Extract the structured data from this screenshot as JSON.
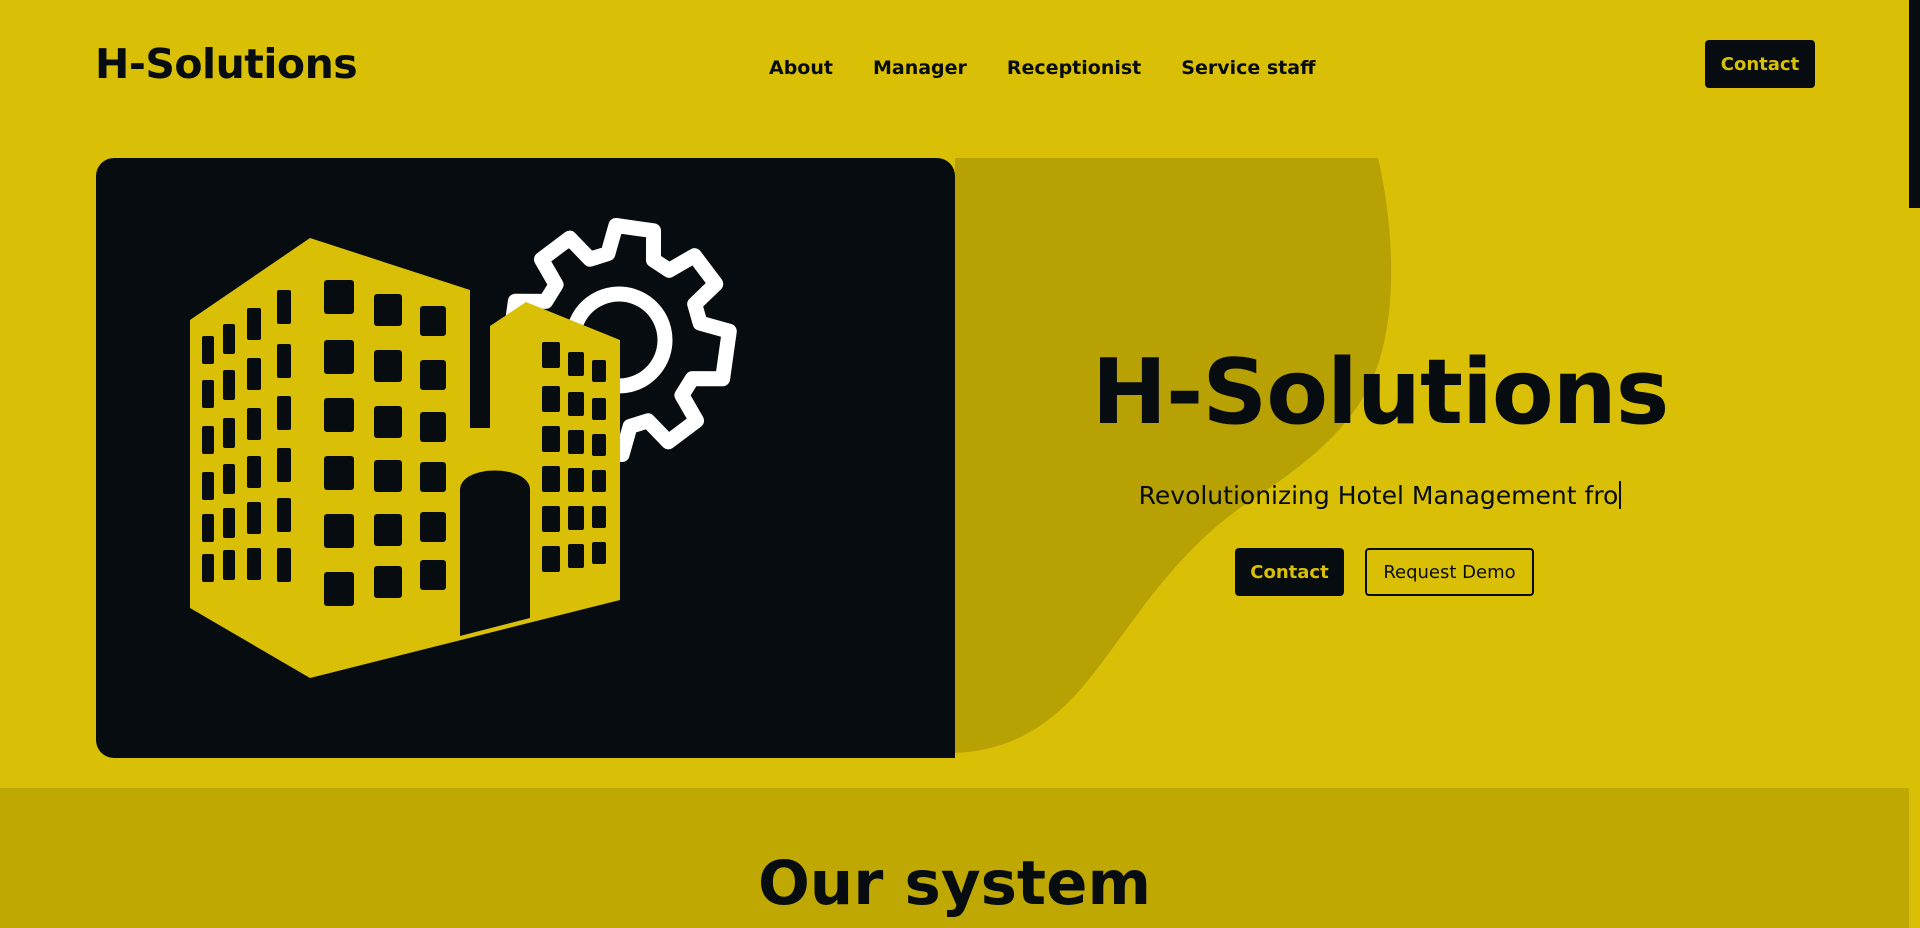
{
  "brand": {
    "logo_text": "H-Solutions"
  },
  "nav": {
    "items": [
      "About",
      "Manager",
      "Receptionist",
      "Service staff"
    ],
    "contact_label": "Contact"
  },
  "hero": {
    "title": "H-Solutions",
    "subtitle": "Revolutionizing Hotel Management fro",
    "contact_label": "Contact",
    "demo_label": "Request Demo",
    "illustration_icons": [
      "hotel-building-icon",
      "gear-icon"
    ]
  },
  "system": {
    "title": "Our system"
  },
  "colors": {
    "background": "#d9c006",
    "dark": "#070c10",
    "blob": "#b8a102",
    "section": "#bfa802",
    "gear": "#ffffff"
  }
}
